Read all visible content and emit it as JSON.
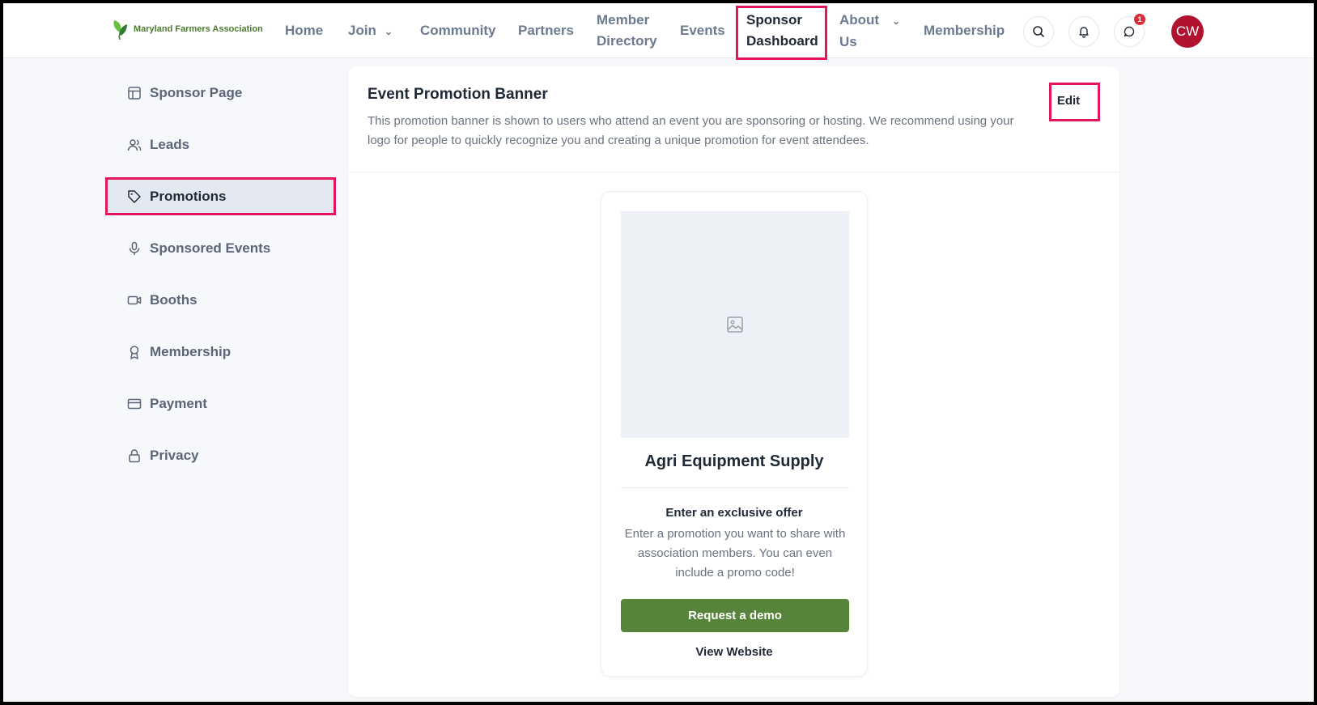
{
  "header": {
    "logo_text": "Maryland Farmers Association",
    "nav": {
      "home": "Home",
      "join": "Join",
      "community": "Community",
      "partners": "Partners",
      "member_directory_1": "Member",
      "member_directory_2": "Directory",
      "events": "Events",
      "sponsor_dashboard_1": "Sponsor",
      "sponsor_dashboard_2": "Dashboard",
      "about_1": "About",
      "about_2": "Us",
      "membership": "Membership"
    },
    "chat_badge_count": "1",
    "avatar_initials": "CW",
    "icons": [
      "search-icon",
      "bell-icon",
      "chat-icon"
    ]
  },
  "sidebar": {
    "items": [
      {
        "label": "Sponsor Page",
        "icon": "layout-icon"
      },
      {
        "label": "Leads",
        "icon": "users-icon"
      },
      {
        "label": "Promotions",
        "icon": "tag-icon",
        "active": true
      },
      {
        "label": "Sponsored Events",
        "icon": "microphone-icon"
      },
      {
        "label": "Booths",
        "icon": "video-icon"
      },
      {
        "label": "Membership",
        "icon": "award-icon"
      },
      {
        "label": "Payment",
        "icon": "credit-card-icon"
      },
      {
        "label": "Privacy",
        "icon": "lock-icon"
      }
    ]
  },
  "main": {
    "title": "Event Promotion Banner",
    "description": "This promotion banner is shown to users who attend an event you are sponsoring or hosting. We recommend using your logo for people to quickly recognize you and creating a unique promotion for event attendees.",
    "edit_label": "Edit",
    "promo": {
      "company_name": "Agri Equipment Supply",
      "offer_title": "Enter an exclusive offer",
      "offer_description": "Enter a promotion you want to share with association members. You can even include a promo code!",
      "demo_button": "Request a demo",
      "website_link": "View Website"
    }
  },
  "colors": {
    "highlight": "#e3165b",
    "brand_green": "#56843a",
    "avatar_red": "#b0122f",
    "badge_red": "#d9303a"
  }
}
